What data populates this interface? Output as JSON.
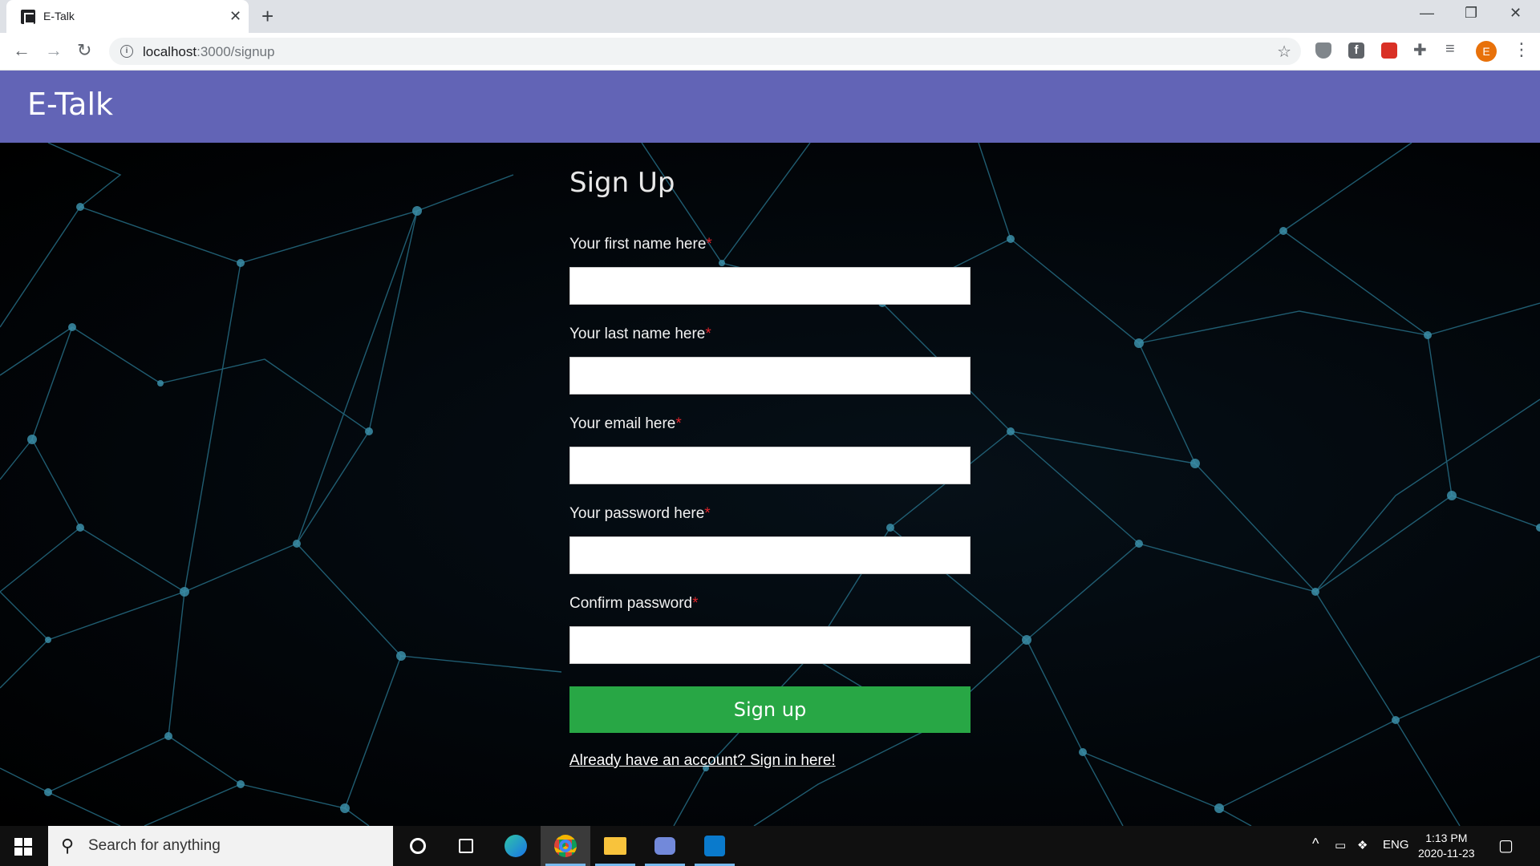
{
  "browser": {
    "tab_title": "E-Talk",
    "tab_close": "✕",
    "new_tab": "+",
    "url_host": "localhost",
    "url_path": ":3000/signup",
    "avatar_letter": "E",
    "window_controls": {
      "minimize": "—",
      "restore": "❐",
      "close": "✕"
    }
  },
  "app": {
    "brand": "E-Talk"
  },
  "form": {
    "title": "Sign Up",
    "fields": [
      {
        "label": "Your first name here",
        "required": "*",
        "value": ""
      },
      {
        "label": "Your last name here",
        "required": "*",
        "value": ""
      },
      {
        "label": "Your email here",
        "required": "*",
        "value": ""
      },
      {
        "label": "Your password here",
        "required": "*",
        "value": ""
      },
      {
        "label": "Confirm password",
        "required": "*",
        "value": ""
      }
    ],
    "submit_label": "Sign up",
    "signin_link": "Already have an account? Sign in here!"
  },
  "taskbar": {
    "search_placeholder": "Search for anything",
    "language": "ENG",
    "time": "1:13 PM",
    "date": "2020-11-23"
  },
  "colors": {
    "appbar": "#6264b6",
    "submit": "#28a745",
    "required": "#e0242b",
    "network_lines": "#2a7a94"
  }
}
